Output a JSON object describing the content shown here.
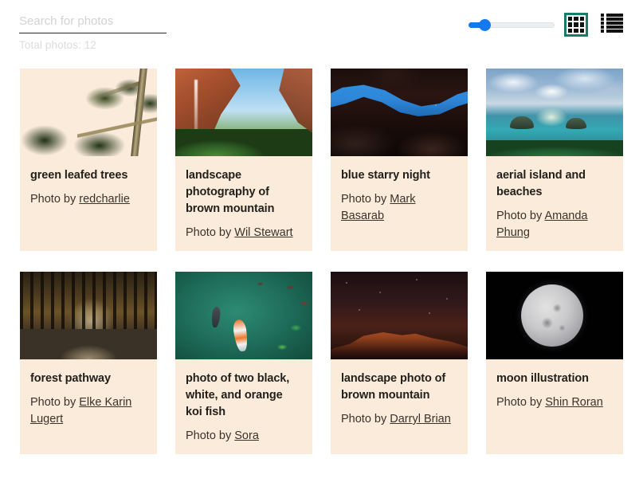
{
  "toolbar": {
    "search": {
      "placeholder": "Search for photos",
      "value": ""
    },
    "total_photos_label": "Total photos: 12",
    "slider": {
      "name": "size-slider",
      "value": 12,
      "min": 0,
      "max": 100
    },
    "view_grid": {
      "icon": "grid-view-icon",
      "selected": true,
      "accent_color": "#1a7b66"
    },
    "view_list": {
      "icon": "list-view-icon",
      "selected": false
    }
  },
  "gallery": {
    "card_background": "#faebda",
    "credit_prefix": "Photo by ",
    "photos": [
      {
        "title": "green leafed trees",
        "credit_prefix": "Photo by ",
        "author": "redcharlie",
        "art": "ph-trees"
      },
      {
        "title": "landscape photography of brown mountain",
        "credit_prefix": "Photo by ",
        "author": "Wil Stewart",
        "art": "ph-canyon"
      },
      {
        "title": "blue starry night",
        "credit_prefix": "Photo by ",
        "author": "Mark Basarab",
        "art": "ph-starry"
      },
      {
        "title": "aerial island and beaches",
        "credit_prefix": "Photo by ",
        "author": "Amanda Phung",
        "art": "ph-island"
      },
      {
        "title": "forest pathway",
        "credit_prefix": "Photo by ",
        "author": "Elke Karin Lugert",
        "art": "ph-path"
      },
      {
        "title": "photo of two black, white, and orange koi fish",
        "credit_prefix": "Photo by ",
        "author": "Sora",
        "art": "ph-koi"
      },
      {
        "title": "landscape photo of brown mountain",
        "credit_prefix": "Photo by ",
        "author": "Darryl Brian",
        "art": "ph-redrock"
      },
      {
        "title": "moon illustration",
        "credit_prefix": "Photo by ",
        "author": "Shin Roran",
        "art": "ph-moon"
      }
    ]
  }
}
